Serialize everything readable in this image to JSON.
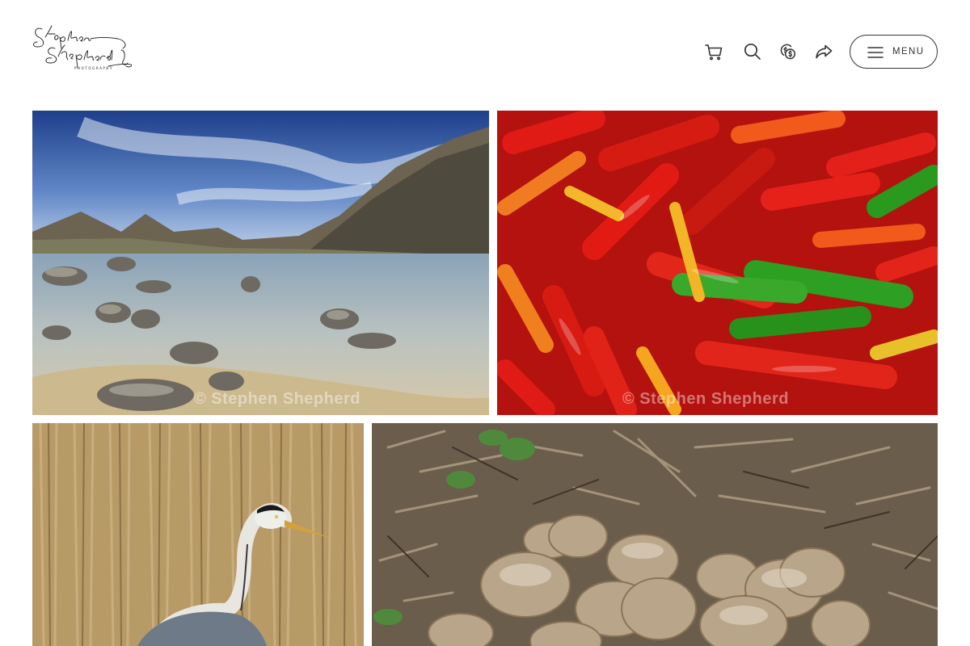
{
  "site": {
    "logo_text": "Stephen Shepherd",
    "logo_subtitle": "PHOTOGRAPHY"
  },
  "header": {
    "icons": [
      "cart-icon",
      "search-icon",
      "currency-icon",
      "share-icon"
    ],
    "menu_label": "MENU"
  },
  "gallery": {
    "watermark": "© Stephen Shepherd",
    "tiles": [
      {
        "name": "lake-mountains-photo",
        "subject": "mountain lake with rocks"
      },
      {
        "name": "chillies-photo",
        "subject": "red and green chillies"
      },
      {
        "name": "heron-photo",
        "subject": "grey heron in reeds"
      },
      {
        "name": "fungi-photo",
        "subject": "cluster of puffball fungi"
      }
    ]
  },
  "colors": {
    "text": "#333333",
    "background": "#ffffff"
  }
}
